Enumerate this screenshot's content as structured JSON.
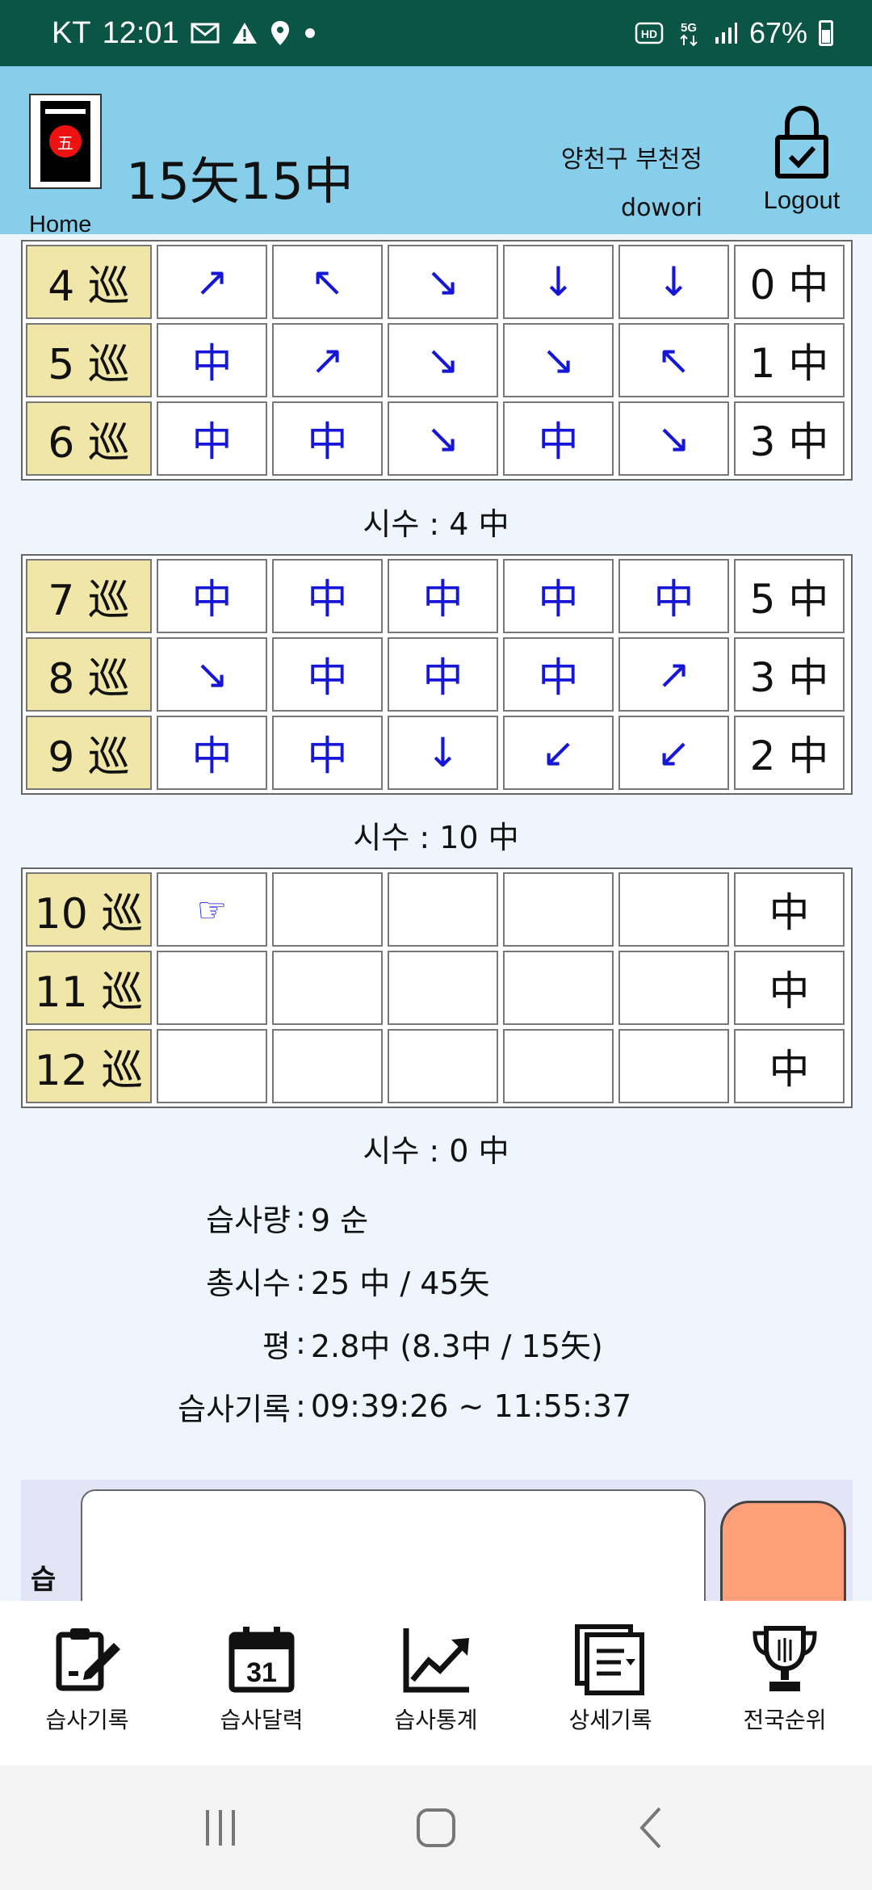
{
  "status_bar": {
    "carrier": "KT",
    "time": "12:01",
    "battery": "67%",
    "icons": [
      "mail-icon",
      "warning-icon",
      "location-icon",
      "dot-icon",
      "hd-icon",
      "5g-icon",
      "signal-icon",
      "battery-icon"
    ]
  },
  "header": {
    "logo_char": "五",
    "home_label": "Home",
    "title": "15矢15中",
    "region": "양천구 부천정",
    "username": "dowori",
    "logout_label": "Logout"
  },
  "blocks": [
    {
      "rows": [
        {
          "round": "4 巡",
          "shots": [
            "↗",
            "↖",
            "↘",
            "↓",
            "↓"
          ],
          "score": "0 中"
        },
        {
          "round": "5 巡",
          "shots": [
            "中",
            "↗",
            "↘",
            "↘",
            "↖"
          ],
          "score": "1 中"
        },
        {
          "round": "6 巡",
          "shots": [
            "中",
            "中",
            "↘",
            "中",
            "↘"
          ],
          "score": "3 中"
        }
      ],
      "sisu": "시수 : 4 中"
    },
    {
      "rows": [
        {
          "round": "7 巡",
          "shots": [
            "中",
            "中",
            "中",
            "中",
            "中"
          ],
          "score": "5 中"
        },
        {
          "round": "8 巡",
          "shots": [
            "↘",
            "中",
            "中",
            "中",
            "↗"
          ],
          "score": "3 中"
        },
        {
          "round": "9 巡",
          "shots": [
            "中",
            "中",
            "↓",
            "↙",
            "↙"
          ],
          "score": "2 中"
        }
      ],
      "sisu": "시수 : 10 中"
    },
    {
      "rows": [
        {
          "round": "10 巡",
          "shots": [
            "☞",
            "",
            "",
            "",
            ""
          ],
          "score": "中"
        },
        {
          "round": "11 巡",
          "shots": [
            "",
            "",
            "",
            "",
            ""
          ],
          "score": "中"
        },
        {
          "round": "12 巡",
          "shots": [
            "",
            "",
            "",
            "",
            ""
          ],
          "score": "中"
        }
      ],
      "sisu": "시수 : 0 中"
    }
  ],
  "stats": {
    "practice_label": "습사량",
    "practice_value": "9 순",
    "total_label": "총시수",
    "total_value": "25 中 / 45矢",
    "avg_label": "평",
    "avg_value": "2.8中 (8.3中 / 15矢)",
    "record_label": "습사기록",
    "record_value": "09:39:26 ~ 11:55:37",
    "separator": ":"
  },
  "input": {
    "label": "습"
  },
  "bottom_nav": [
    {
      "label": "습사기록",
      "icon": "clipboard-pen-icon"
    },
    {
      "label": "습사달력",
      "icon": "calendar-icon",
      "day": "31"
    },
    {
      "label": "습사통계",
      "icon": "chart-trend-icon"
    },
    {
      "label": "상세기록",
      "icon": "document-list-icon"
    },
    {
      "label": "전국순위",
      "icon": "trophy-icon"
    }
  ],
  "colors": {
    "status_bar": "#0b5546",
    "header": "#87ceeb",
    "round_cell": "#efe6a8",
    "shot_text": "#1616d8",
    "submit_button": "#ff9f7a"
  }
}
